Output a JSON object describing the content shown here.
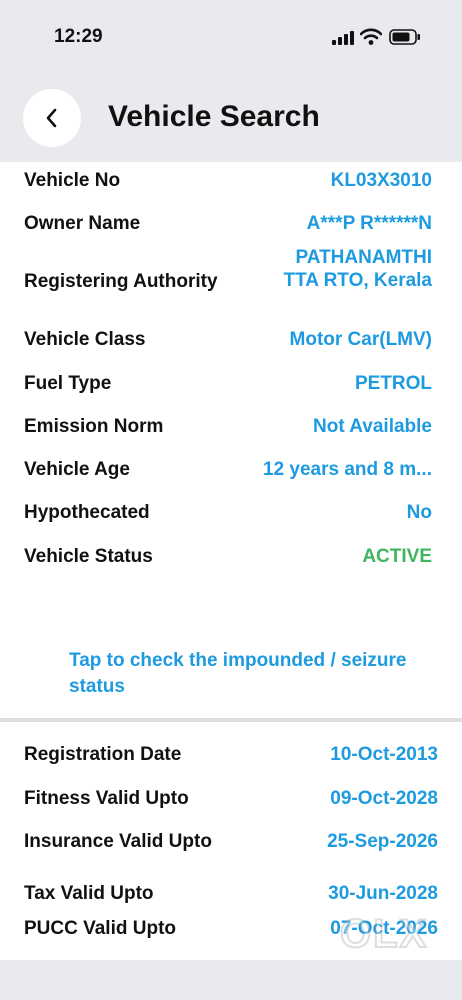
{
  "status_bar": {
    "time": "12:29"
  },
  "header": {
    "title": "Vehicle Search"
  },
  "vehicle": [
    {
      "label": "Vehicle No",
      "value": "KL03X3010",
      "status": "normal"
    },
    {
      "label": "Owner Name",
      "value": "A***P R******N",
      "status": "normal"
    },
    {
      "label": "Registering Authority",
      "value": "PATHANAMTHI TTA RTO, Kerala",
      "status": "multi"
    },
    {
      "label": "Vehicle Class",
      "value": "Motor Car(LMV)",
      "status": "normal"
    },
    {
      "label": "Fuel Type",
      "value": "PETROL",
      "status": "normal"
    },
    {
      "label": "Emission Norm",
      "value": "Not Available",
      "status": "normal"
    },
    {
      "label": "Vehicle Age",
      "value": "12 years and 8 m...",
      "status": "normal"
    },
    {
      "label": "Hypothecated",
      "value": "No",
      "status": "normal"
    },
    {
      "label": "Vehicle Status",
      "value": "ACTIVE",
      "status": "active"
    }
  ],
  "impound_link": "Tap to check the impounded / seizure status",
  "dates": [
    {
      "label": "Registration Date",
      "value": "10-Oct-2013"
    },
    {
      "label": "Fitness Valid Upto",
      "value": "09-Oct-2028"
    },
    {
      "label": "Insurance Valid Upto",
      "value": "25-Sep-2026"
    },
    {
      "label": "Tax Valid Upto",
      "value": "30-Jun-2028"
    },
    {
      "label": "PUCC Valid Upto",
      "value": "07-Oct-2026"
    }
  ],
  "watermark": "OLX",
  "colors": {
    "accent": "#1e9be0",
    "active": "#3fb55f",
    "background": "#e9eaee"
  },
  "icons": {
    "back": "chevron-left-icon",
    "signal": "cellular-signal-icon",
    "wifi": "wifi-icon",
    "battery": "battery-icon"
  }
}
